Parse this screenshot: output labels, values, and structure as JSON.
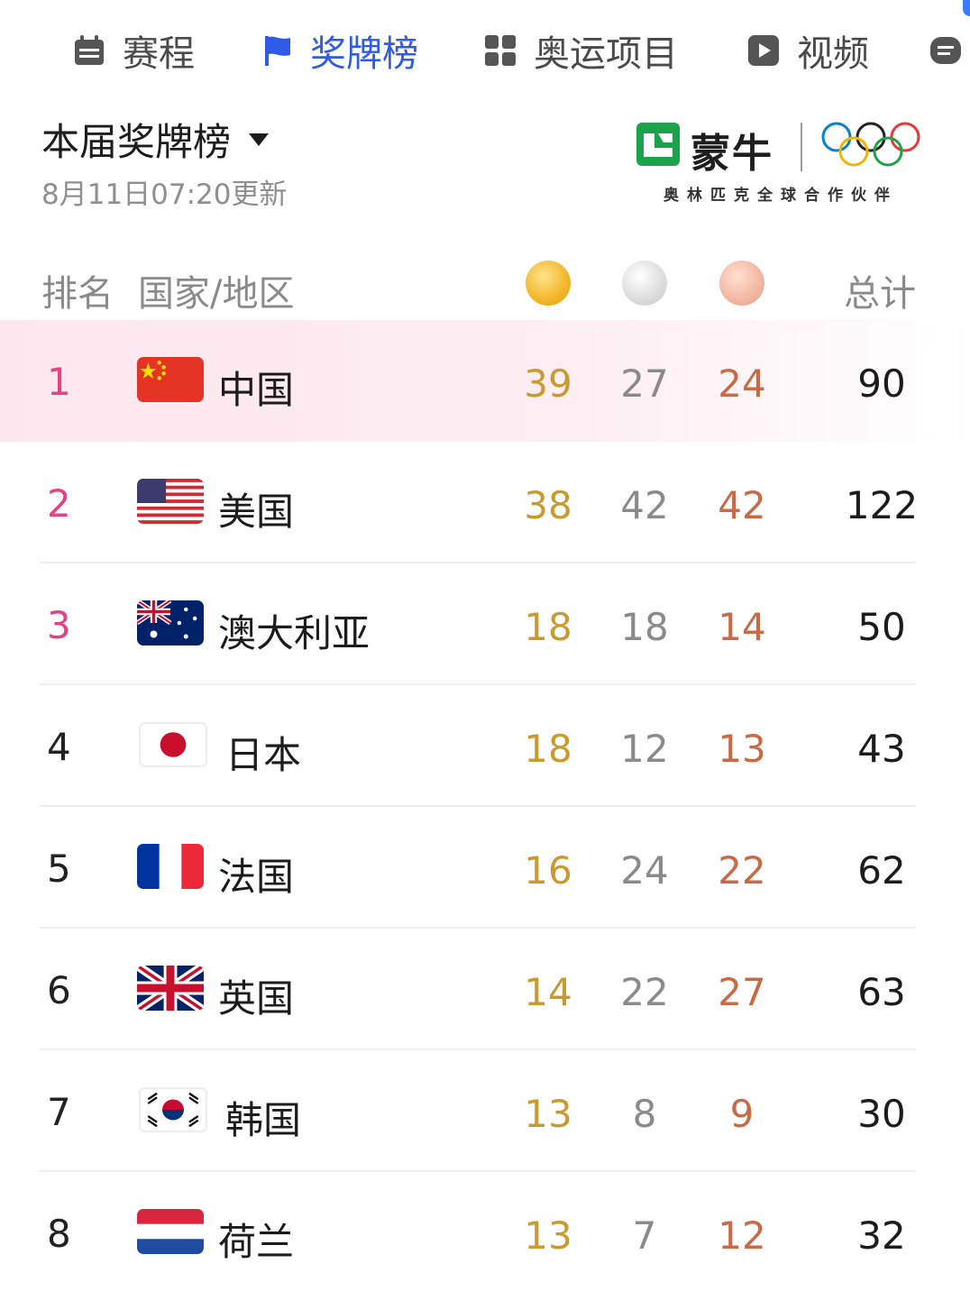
{
  "tabs": [
    {
      "label": "赛程",
      "icon": "calendar-icon",
      "active": false
    },
    {
      "label": "奖牌榜",
      "icon": "flag-icon",
      "active": true
    },
    {
      "label": "奥运项目",
      "icon": "grid-icon",
      "active": false
    },
    {
      "label": "视频",
      "icon": "play-icon",
      "active": false
    }
  ],
  "header": {
    "title": "本届奖牌榜",
    "updated": "8月11日07:20更新"
  },
  "sponsor": {
    "brand": "蒙牛",
    "partner_text": "奥林匹克全球合作伙伴"
  },
  "table_header": {
    "rank": "排名",
    "country": "国家/地区",
    "total": "总计"
  },
  "colors": {
    "accent": "#2f5be6",
    "rank_top": "#e54283",
    "gold": "#c99a2e",
    "silver": "#8a8a8a",
    "bronze": "#c96a47",
    "highlight_row": "#fde7ef"
  },
  "rows": [
    {
      "rank": "1",
      "country": "中国",
      "flag": "china-flag",
      "gold": "39",
      "silver": "27",
      "bronze": "24",
      "total": "90"
    },
    {
      "rank": "2",
      "country": "美国",
      "flag": "usa-flag",
      "gold": "38",
      "silver": "42",
      "bronze": "42",
      "total": "122"
    },
    {
      "rank": "3",
      "country": "澳大利亚",
      "flag": "australia-flag",
      "gold": "18",
      "silver": "18",
      "bronze": "14",
      "total": "50"
    },
    {
      "rank": "4",
      "country": "日本",
      "flag": "japan-flag",
      "gold": "18",
      "silver": "12",
      "bronze": "13",
      "total": "43"
    },
    {
      "rank": "5",
      "country": "法国",
      "flag": "france-flag",
      "gold": "16",
      "silver": "24",
      "bronze": "22",
      "total": "62"
    },
    {
      "rank": "6",
      "country": "英国",
      "flag": "uk-flag",
      "gold": "14",
      "silver": "22",
      "bronze": "27",
      "total": "63"
    },
    {
      "rank": "7",
      "country": "韩国",
      "flag": "korea-flag",
      "gold": "13",
      "silver": "8",
      "bronze": "9",
      "total": "30"
    },
    {
      "rank": "8",
      "country": "荷兰",
      "flag": "netherlands-flag",
      "gold": "13",
      "silver": "7",
      "bronze": "12",
      "total": "32"
    }
  ]
}
